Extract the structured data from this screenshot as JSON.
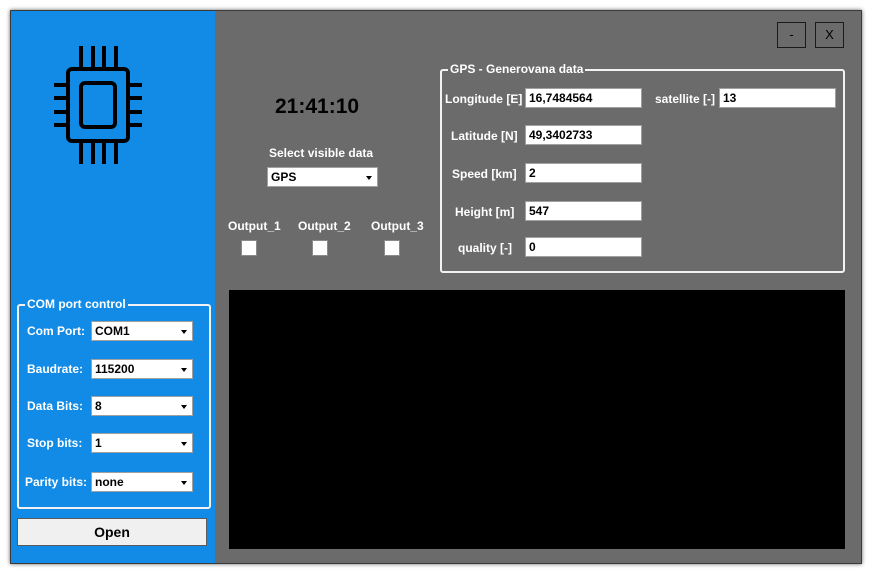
{
  "window": {
    "minimize_label": "-",
    "close_label": "X"
  },
  "sidebar": {
    "logo_icon": "cpu-chip-icon",
    "com_group": {
      "title": "COM port control",
      "fields": [
        {
          "label": "Com Port:",
          "value": "COM1"
        },
        {
          "label": "Baudrate:",
          "value": "115200"
        },
        {
          "label": "Data Bits:",
          "value": "8"
        },
        {
          "label": "Stop bits:",
          "value": "1"
        },
        {
          "label": "Parity bits:",
          "value": "none"
        }
      ]
    },
    "open_label": "Open"
  },
  "main": {
    "clock": "21:41:10",
    "select_visible_label": "Select visible data",
    "select_visible_value": "GPS",
    "outputs": [
      {
        "label": "Output_1",
        "checked": false
      },
      {
        "label": "Output_2",
        "checked": false
      },
      {
        "label": "Output_3",
        "checked": false
      }
    ],
    "gps_group": {
      "title": "GPS - Generovana data",
      "longitude": {
        "label": "Longitude [E]",
        "value": "16,7484564"
      },
      "satellite": {
        "label": "satellite [-]",
        "value": "13"
      },
      "latitude": {
        "label": "Latitude [N]",
        "value": "49,3402733"
      },
      "speed": {
        "label": "Speed [km]",
        "value": "2"
      },
      "height": {
        "label": "Height [m]",
        "value": "547"
      },
      "quality": {
        "label": "quality [-]",
        "value": "0"
      }
    },
    "console_text": ""
  },
  "colors": {
    "sidebar": "#118be6",
    "main_background": "#6b6b6b",
    "console_background": "#000000"
  }
}
